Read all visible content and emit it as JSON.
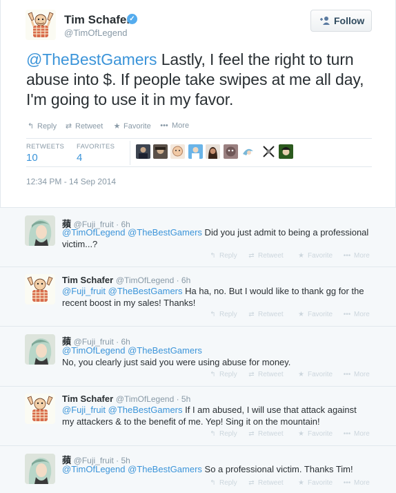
{
  "main_tweet": {
    "author_name": "Tim Schafer",
    "verified_glyph": "✓",
    "author_handle": "@TimOfLegend",
    "follow_label": "Follow",
    "text_mention": "@TheBestGamers",
    "text_body": " Lastly, I feel the right to turn abuse into $. If people take swipes at me all day, I'm going to use it in my favor.",
    "actions": {
      "reply": "Reply",
      "retweet": "Retweet",
      "favorite": "Favorite",
      "more": "More"
    },
    "stats": {
      "retweets_label": "RETWEETS",
      "retweets_value": "10",
      "favorites_label": "FAVORITES",
      "favorites_value": "4"
    },
    "timestamp": "12:34 PM - 14 Sep 2014"
  },
  "replies": [
    {
      "name": "蘋",
      "handle": "@Fuji_fruit · 6h",
      "mention": "@TimOfLegend @TheBestGamers",
      "lines": [
        " Did you just admit to being a professional",
        "victim...?"
      ],
      "avatar": "fuji"
    },
    {
      "name": "Tim Schafer",
      "handle": "@TimOfLegend · 6h",
      "mention": "@Fuji_fruit @TheBestGamers",
      "lines": [
        " Ha ha, no. But I would like to thank gg for the",
        "recent boost in my sales! Thanks!"
      ],
      "avatar": "tim"
    },
    {
      "name": "蘋",
      "handle": "@Fuji_fruit · 6h",
      "mention": "@TimOfLegend @TheBestGamers",
      "lines": [
        "",
        "No, you clearly just said you were using abuse for money."
      ],
      "avatar": "fuji"
    },
    {
      "name": "Tim Schafer",
      "handle": "@TimOfLegend · 5h",
      "mention": "@Fuji_fruit @TheBestGamers",
      "lines": [
        " If I am abused, I will use that attack against",
        "my attackers & to the benefit of me. Yep! Sing it on the mountain!"
      ],
      "avatar": "tim"
    },
    {
      "name": "蘋",
      "handle": "@Fuji_fruit · 5h",
      "mention": "@TimOfLegend @TheBestGamers",
      "lines": [
        " So a professional victim. Thanks Tim!",
        ""
      ],
      "avatar": "fuji"
    }
  ],
  "reply_actions": {
    "reply": "Reply",
    "retweet": "Retweet",
    "favorite": "Favorite",
    "more": "More"
  },
  "icons": {
    "reply": "↰",
    "retweet": "⇄",
    "favorite": "★",
    "more": "•••",
    "follow": "+👤"
  },
  "colors": {
    "link": "#3b94d9",
    "muted": "#8899a6",
    "reply_bg": "#f5f8fa",
    "verified": "#55acee"
  }
}
